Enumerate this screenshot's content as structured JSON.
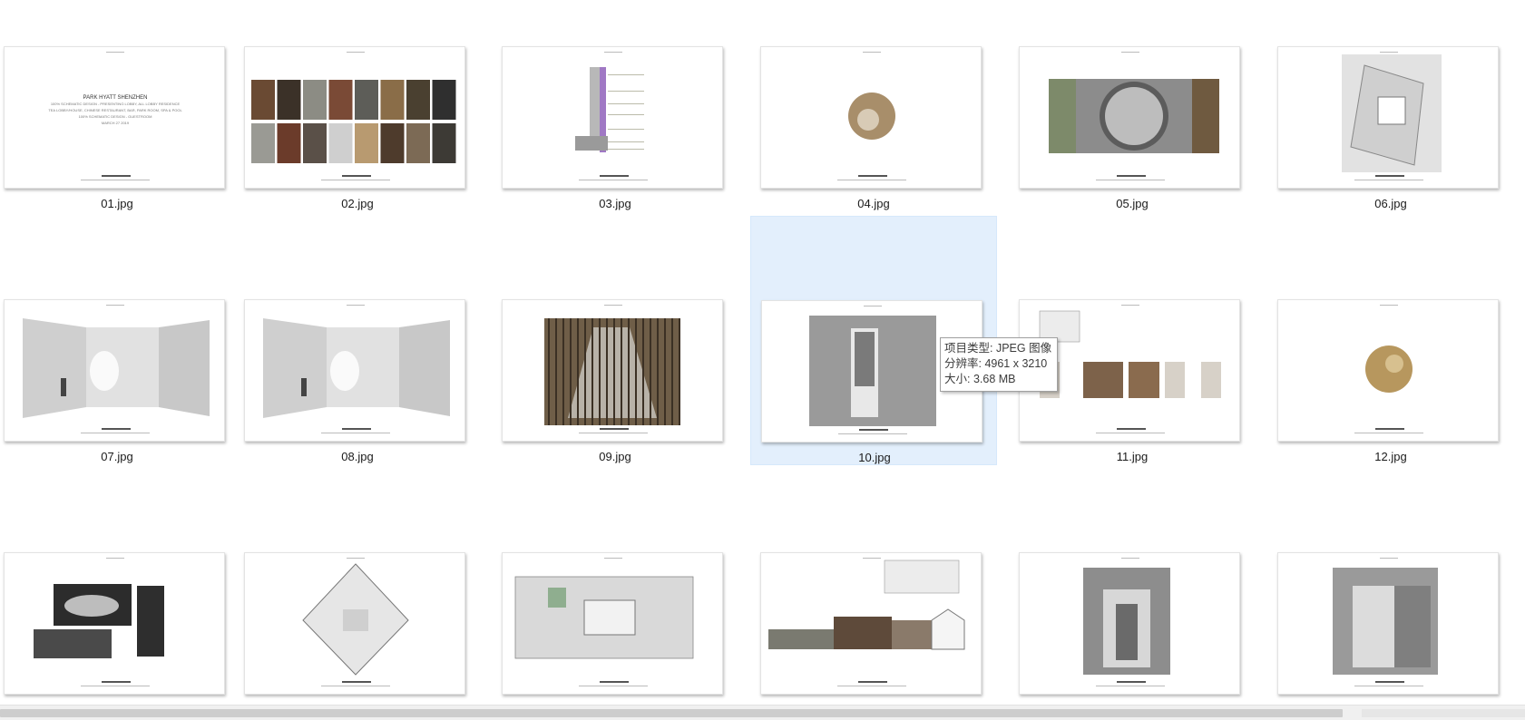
{
  "files": [
    {
      "name": "01.jpg",
      "kind": "cover"
    },
    {
      "name": "02.jpg",
      "kind": "mood-grid"
    },
    {
      "name": "03.jpg",
      "kind": "section-diagram"
    },
    {
      "name": "04.jpg",
      "kind": "round-stone"
    },
    {
      "name": "05.jpg",
      "kind": "moon-gate"
    },
    {
      "name": "06.jpg",
      "kind": "site-plan"
    },
    {
      "name": "07.jpg",
      "kind": "lobby-sketch"
    },
    {
      "name": "08.jpg",
      "kind": "lobby-sketch"
    },
    {
      "name": "09.jpg",
      "kind": "bamboo-corridor"
    },
    {
      "name": "10.jpg",
      "kind": "marble-corridor"
    },
    {
      "name": "11.jpg",
      "kind": "elevation"
    },
    {
      "name": "12.jpg",
      "kind": "round-stone-gold"
    },
    {
      "name": "",
      "kind": "object-collage"
    },
    {
      "name": "",
      "kind": "diamond-plan"
    },
    {
      "name": "",
      "kind": "floor-plan"
    },
    {
      "name": "",
      "kind": "elevation-long"
    },
    {
      "name": "",
      "kind": "doorway-render"
    },
    {
      "name": "",
      "kind": "doorway-render-2"
    }
  ],
  "cover_text": {
    "brand": "PARK HYATT SHENZHEN",
    "line1": "100% SCHEMATIC DESIGN - PRESENTING LOBBY, ALL LOBBY RESIDENCE",
    "line2": "TEA LOBBY/HOUSE, CHINESE RESTAURANT, BAR, PARK ROOM, SPA & POOL",
    "line3": "100% SCHEMATIC DESIGN - GUESTROOM",
    "date": "MARCH 27 2019"
  },
  "selected_index": 9,
  "tooltip": {
    "type_line": "项目类型: JPEG 图像",
    "resolution_line": "分辨率: 4961 x 3210",
    "size_line": "大小: 3.68 MB"
  },
  "colors": {
    "selection_fill": "#e3effc",
    "selection_border": "#d6e8fb"
  }
}
